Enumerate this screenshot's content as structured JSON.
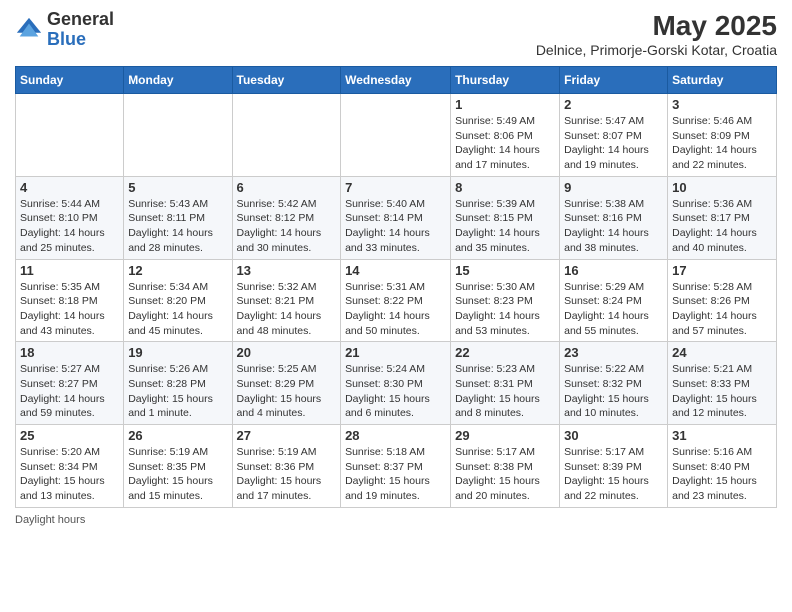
{
  "header": {
    "logo_general": "General",
    "logo_blue": "Blue",
    "month_year": "May 2025",
    "location": "Delnice, Primorje-Gorski Kotar, Croatia"
  },
  "days_of_week": [
    "Sunday",
    "Monday",
    "Tuesday",
    "Wednesday",
    "Thursday",
    "Friday",
    "Saturday"
  ],
  "footer": {
    "daylight_hours": "Daylight hours"
  },
  "weeks": [
    {
      "days": [
        {
          "num": "",
          "info": ""
        },
        {
          "num": "",
          "info": ""
        },
        {
          "num": "",
          "info": ""
        },
        {
          "num": "",
          "info": ""
        },
        {
          "num": "1",
          "info": "Sunrise: 5:49 AM\nSunset: 8:06 PM\nDaylight: 14 hours\nand 17 minutes."
        },
        {
          "num": "2",
          "info": "Sunrise: 5:47 AM\nSunset: 8:07 PM\nDaylight: 14 hours\nand 19 minutes."
        },
        {
          "num": "3",
          "info": "Sunrise: 5:46 AM\nSunset: 8:09 PM\nDaylight: 14 hours\nand 22 minutes."
        }
      ]
    },
    {
      "days": [
        {
          "num": "4",
          "info": "Sunrise: 5:44 AM\nSunset: 8:10 PM\nDaylight: 14 hours\nand 25 minutes."
        },
        {
          "num": "5",
          "info": "Sunrise: 5:43 AM\nSunset: 8:11 PM\nDaylight: 14 hours\nand 28 minutes."
        },
        {
          "num": "6",
          "info": "Sunrise: 5:42 AM\nSunset: 8:12 PM\nDaylight: 14 hours\nand 30 minutes."
        },
        {
          "num": "7",
          "info": "Sunrise: 5:40 AM\nSunset: 8:14 PM\nDaylight: 14 hours\nand 33 minutes."
        },
        {
          "num": "8",
          "info": "Sunrise: 5:39 AM\nSunset: 8:15 PM\nDaylight: 14 hours\nand 35 minutes."
        },
        {
          "num": "9",
          "info": "Sunrise: 5:38 AM\nSunset: 8:16 PM\nDaylight: 14 hours\nand 38 minutes."
        },
        {
          "num": "10",
          "info": "Sunrise: 5:36 AM\nSunset: 8:17 PM\nDaylight: 14 hours\nand 40 minutes."
        }
      ]
    },
    {
      "days": [
        {
          "num": "11",
          "info": "Sunrise: 5:35 AM\nSunset: 8:18 PM\nDaylight: 14 hours\nand 43 minutes."
        },
        {
          "num": "12",
          "info": "Sunrise: 5:34 AM\nSunset: 8:20 PM\nDaylight: 14 hours\nand 45 minutes."
        },
        {
          "num": "13",
          "info": "Sunrise: 5:32 AM\nSunset: 8:21 PM\nDaylight: 14 hours\nand 48 minutes."
        },
        {
          "num": "14",
          "info": "Sunrise: 5:31 AM\nSunset: 8:22 PM\nDaylight: 14 hours\nand 50 minutes."
        },
        {
          "num": "15",
          "info": "Sunrise: 5:30 AM\nSunset: 8:23 PM\nDaylight: 14 hours\nand 53 minutes."
        },
        {
          "num": "16",
          "info": "Sunrise: 5:29 AM\nSunset: 8:24 PM\nDaylight: 14 hours\nand 55 minutes."
        },
        {
          "num": "17",
          "info": "Sunrise: 5:28 AM\nSunset: 8:26 PM\nDaylight: 14 hours\nand 57 minutes."
        }
      ]
    },
    {
      "days": [
        {
          "num": "18",
          "info": "Sunrise: 5:27 AM\nSunset: 8:27 PM\nDaylight: 14 hours\nand 59 minutes."
        },
        {
          "num": "19",
          "info": "Sunrise: 5:26 AM\nSunset: 8:28 PM\nDaylight: 15 hours\nand 1 minute."
        },
        {
          "num": "20",
          "info": "Sunrise: 5:25 AM\nSunset: 8:29 PM\nDaylight: 15 hours\nand 4 minutes."
        },
        {
          "num": "21",
          "info": "Sunrise: 5:24 AM\nSunset: 8:30 PM\nDaylight: 15 hours\nand 6 minutes."
        },
        {
          "num": "22",
          "info": "Sunrise: 5:23 AM\nSunset: 8:31 PM\nDaylight: 15 hours\nand 8 minutes."
        },
        {
          "num": "23",
          "info": "Sunrise: 5:22 AM\nSunset: 8:32 PM\nDaylight: 15 hours\nand 10 minutes."
        },
        {
          "num": "24",
          "info": "Sunrise: 5:21 AM\nSunset: 8:33 PM\nDaylight: 15 hours\nand 12 minutes."
        }
      ]
    },
    {
      "days": [
        {
          "num": "25",
          "info": "Sunrise: 5:20 AM\nSunset: 8:34 PM\nDaylight: 15 hours\nand 13 minutes."
        },
        {
          "num": "26",
          "info": "Sunrise: 5:19 AM\nSunset: 8:35 PM\nDaylight: 15 hours\nand 15 minutes."
        },
        {
          "num": "27",
          "info": "Sunrise: 5:19 AM\nSunset: 8:36 PM\nDaylight: 15 hours\nand 17 minutes."
        },
        {
          "num": "28",
          "info": "Sunrise: 5:18 AM\nSunset: 8:37 PM\nDaylight: 15 hours\nand 19 minutes."
        },
        {
          "num": "29",
          "info": "Sunrise: 5:17 AM\nSunset: 8:38 PM\nDaylight: 15 hours\nand 20 minutes."
        },
        {
          "num": "30",
          "info": "Sunrise: 5:17 AM\nSunset: 8:39 PM\nDaylight: 15 hours\nand 22 minutes."
        },
        {
          "num": "31",
          "info": "Sunrise: 5:16 AM\nSunset: 8:40 PM\nDaylight: 15 hours\nand 23 minutes."
        }
      ]
    }
  ]
}
